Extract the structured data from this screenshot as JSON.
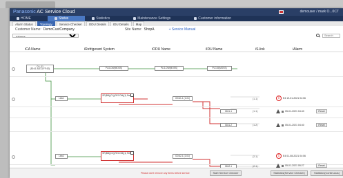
{
  "app": {
    "brand": "Panasonic",
    "title": "AC Service Cloud",
    "user": "demouser / mark O...0CT"
  },
  "menu": [
    {
      "label": "HOME",
      "icon": "home-icon"
    },
    {
      "label": "Status",
      "icon": "status-icon",
      "active": true
    },
    {
      "label": "Statistics",
      "icon": "chart-icon"
    },
    {
      "label": "Maintenance Settings",
      "icon": "wrench-icon"
    },
    {
      "label": "Customer information",
      "icon": "person-icon"
    }
  ],
  "subtabs": [
    {
      "label": "Alarm Status"
    },
    {
      "label": "Topology",
      "active": true
    },
    {
      "label": "Service Checker"
    },
    {
      "label": "ODU Details"
    },
    {
      "label": "IDU Details"
    },
    {
      "label": "Map"
    }
  ],
  "info": {
    "customer_label": "Customer Name:",
    "customer_value": "DemoCustCompany",
    "system_label": "Site Name:",
    "system_value": "ShopA",
    "manual_link": "+ Service Manual"
  },
  "filter": {
    "select_value": "All/area",
    "search_placeholder": "Search"
  },
  "columns": {
    "ca": "iCA Name",
    "ref": "iRefrigerant System",
    "odu": "iODU Name",
    "idu": "iIDU Name",
    "link": "iS-link",
    "alarm": "iAlarm"
  },
  "nodes": {
    "ca": "CA_01 (50:41:AA:11:FF:00)",
    "link1": "Link1",
    "link2": "Link2",
    "ref_top": "PLG-DW(MOSS)",
    "odu_top": "PLG-DW(MOSS)",
    "idu_top": "PLG-B(MOSS)",
    "ref1": "SR(BB)(C1)(RECOM)(1) Ref.1",
    "odu1": "ODU1-1 (1-01)",
    "ref2": "SR(BB)(C2)(RECOM)(1) Ref.1",
    "odu2": "ODU2-1 (2-01)",
    "idu1_1": "IDU1-1",
    "idu1_2": "IDU1-2",
    "idu2_1": "IDU2-1"
  },
  "rows": [
    {
      "link": "(1-1)",
      "alarm_text": "E4 19-01-2021 04:06",
      "kind": "circle"
    },
    {
      "link": "(1-1)",
      "alarm_text": "05-01-2021 04:40",
      "kind": "triangle",
      "reset": "Reset"
    },
    {
      "link": "(1-2)",
      "alarm_text": "05-01-2021 04:40",
      "kind": "triangle",
      "reset": "Reset"
    },
    {
      "link": "(2-1)",
      "alarm_text": "E4 01-08-2021 04:06",
      "kind": "circle"
    },
    {
      "link": "(2-1)",
      "alarm_text": "05-01-2021 05:27",
      "kind": "triangle",
      "reset": "Reset"
    }
  ],
  "footer": {
    "hint": "Please don't remove any items before service",
    "buttons": [
      "Start Service Checker",
      "Statistics(Service Checker)",
      "Statistics(Continuous)"
    ]
  },
  "colors": {
    "title_bg": "#2a3f66",
    "active_tab": "#3a66b0",
    "alarm_red": "#d22222",
    "line_green": "#3a8f3a",
    "line_red": "#d03030"
  }
}
